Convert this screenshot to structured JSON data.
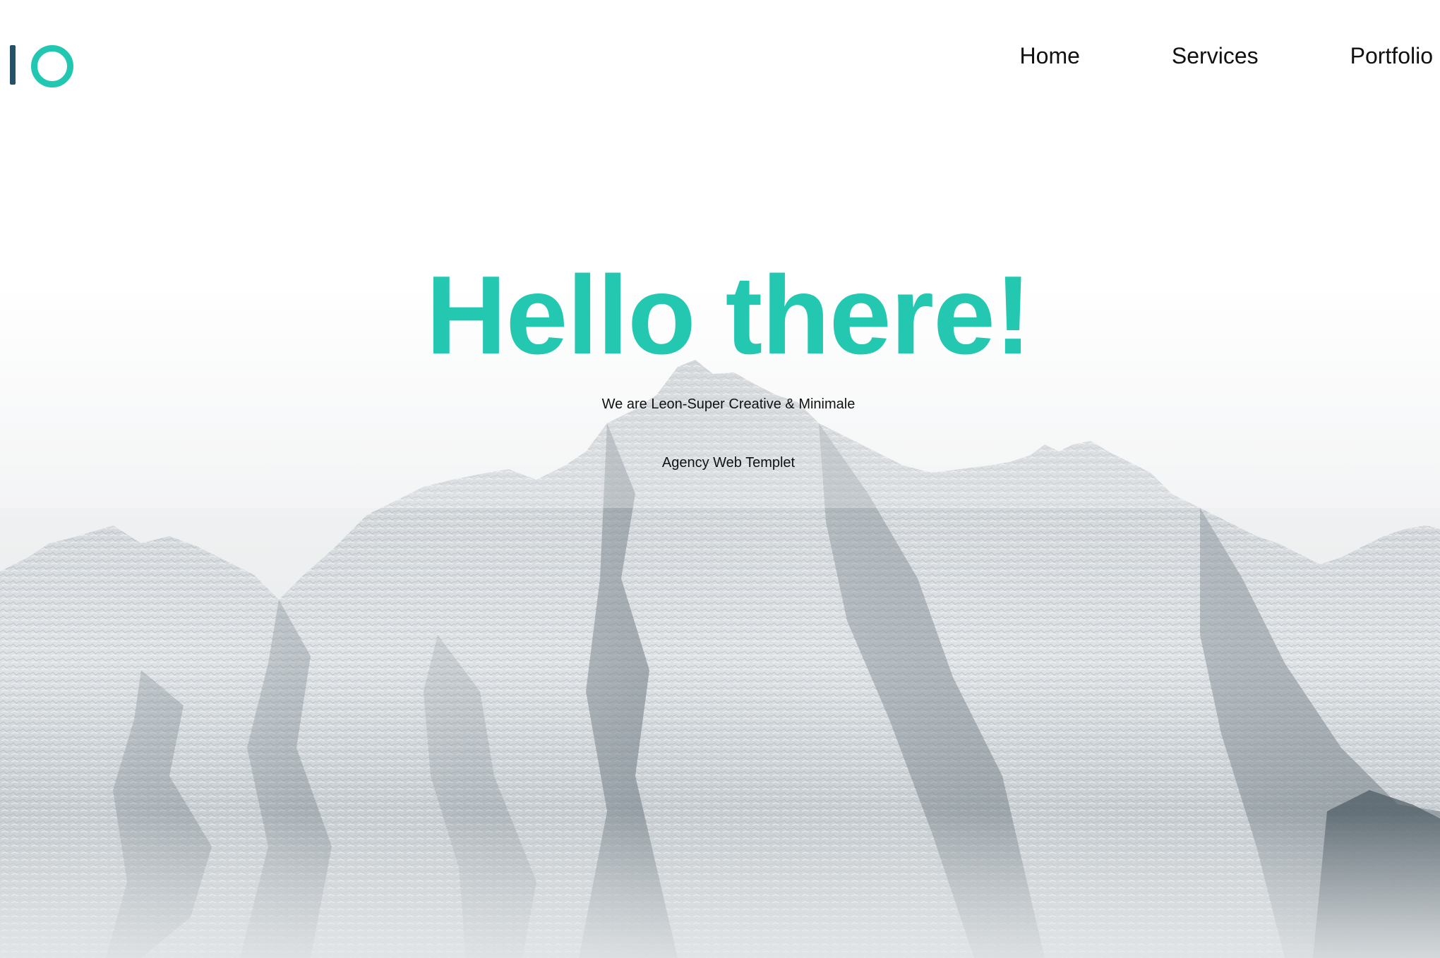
{
  "brand": {
    "logo_icon": "io-logo-icon",
    "bar_color": "#25506a",
    "ring_color": "#22c7b2"
  },
  "nav": {
    "items": [
      {
        "label": "Home"
      },
      {
        "label": "Services"
      },
      {
        "label": "Portfolio"
      }
    ]
  },
  "hero": {
    "title": "Hello there!",
    "subtitle_line1": "We are Leon-Super Creative & Minimale",
    "subtitle_line2": "Agency Web Templet",
    "title_color": "#24c8b0",
    "background": "snowy-mountain-photo"
  }
}
